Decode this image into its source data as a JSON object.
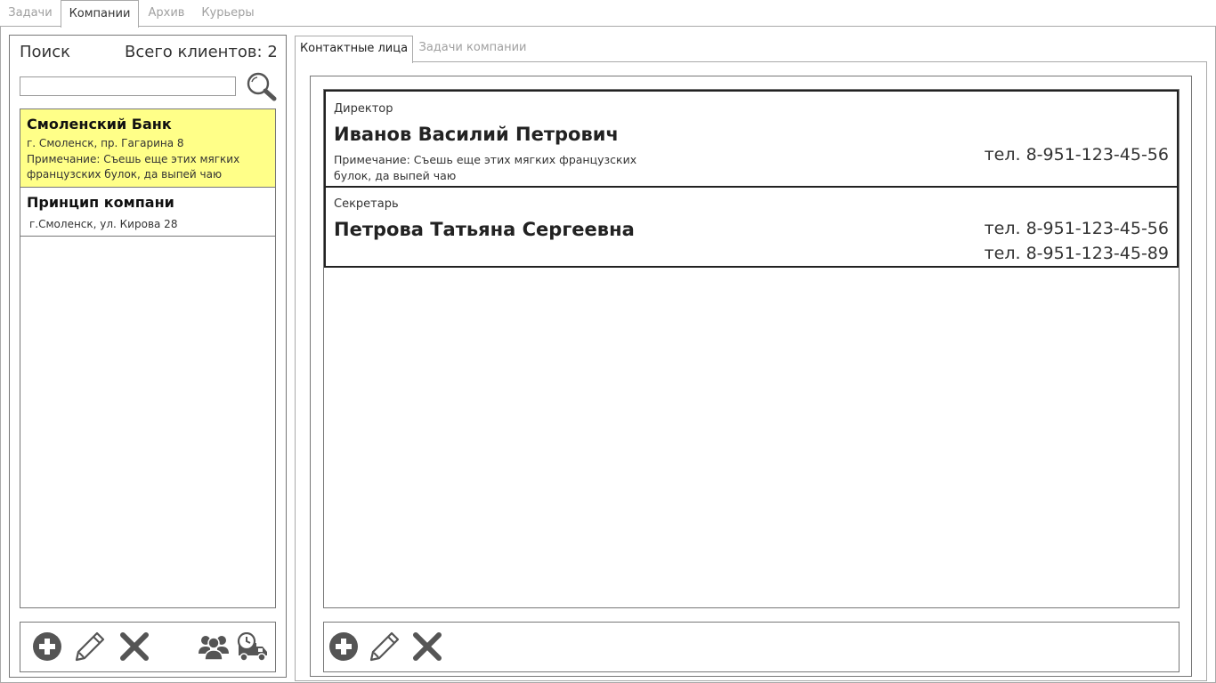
{
  "top_tabs": [
    {
      "label": "Задачи",
      "active": false
    },
    {
      "label": "Компании",
      "active": true
    },
    {
      "label": "Архив",
      "active": false
    },
    {
      "label": "Курьеры",
      "active": false
    }
  ],
  "left": {
    "search_label": "Поиск",
    "total_label": "Всего клиентов: 2",
    "search_value": "",
    "clients": [
      {
        "name": "Смоленский Банк",
        "address": "г. Смоленск, пр. Гагарина 8",
        "note_line1": "Примечание: Съешь еще этих мягких",
        "note_line2": "французских булок, да выпей чаю",
        "selected": true
      },
      {
        "name": "Принцип компани",
        "address": "г.Смоленск, ул. Кирова 28",
        "selected": false
      }
    ]
  },
  "right": {
    "tabs": [
      {
        "label": "Контактные лица",
        "active": true
      },
      {
        "label": "Задачи компании",
        "active": false
      }
    ],
    "contacts": [
      {
        "role": "Директор",
        "name": "Иванов Василий Петрович",
        "note": "Примечание: Съешь еще этих мягких французских булок, да выпей чаю",
        "phones": [
          "тел. 8-951-123-45-56"
        ]
      },
      {
        "role": "Секретарь",
        "name": "Петрова Татьяна Сергеевна",
        "phones": [
          "тел. 8-951-123-45-56",
          "тел. 8-951-123-45-89"
        ]
      }
    ]
  },
  "icons": {
    "add": "plus-circle-icon",
    "edit": "pencil-icon",
    "delete": "cross-icon",
    "contacts": "people-icon",
    "courier": "delivery-truck-clock-icon",
    "search": "magnifier-icon"
  },
  "colors": {
    "selected_row": "#ffff88",
    "icon": "#555555",
    "inactive_tab": "#a0a0a0"
  }
}
